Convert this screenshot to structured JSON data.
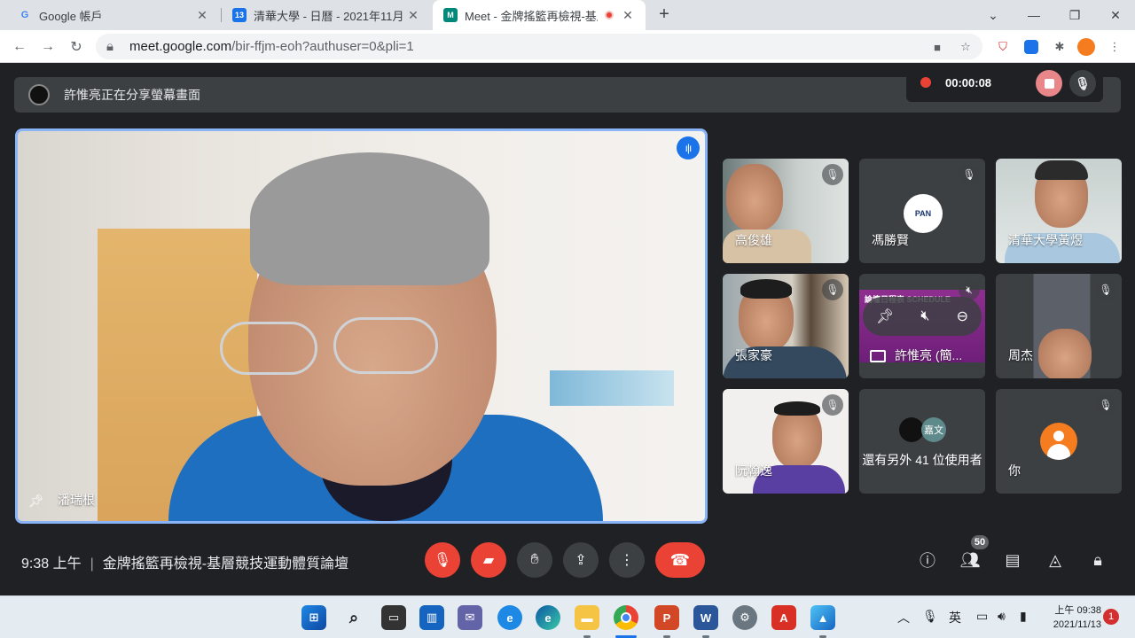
{
  "browser": {
    "tabs": [
      {
        "title": "Google 帳戶",
        "favicon": "G"
      },
      {
        "title": "清華大學 - 日曆 - 2021年11月",
        "favicon": "13"
      },
      {
        "title": "Meet - 金牌搖籃再檢視-基層",
        "favicon": "M"
      }
    ],
    "url_host": "meet.google.com",
    "url_path": "/bir-ffjm-eoh?authuser=0&pli=1"
  },
  "meet": {
    "presenting_banner": "許惟亮正在分享螢幕畫面",
    "recording_time": "00:00:08",
    "main_speaker_name": "潘瑞根",
    "tiles": [
      {
        "name": "高俊雄"
      },
      {
        "name": "馮勝賢"
      },
      {
        "name": "清華大學黃煜"
      },
      {
        "name": "張家豪"
      },
      {
        "name": "許惟亮 (簡..."
      },
      {
        "name": "周杰"
      },
      {
        "name": "阮翰逸"
      },
      {
        "name": "還有另外 41 位使用者"
      },
      {
        "name": "你"
      }
    ],
    "schedule_label": "論壇日程表 SCHEDULE",
    "others_avatar_text": "嘉文",
    "participants_count": "50",
    "time": "9:38 上午",
    "meeting_title": "金牌搖籃再檢視-基層競技運動體質論壇"
  },
  "taskbar": {
    "ime": "英",
    "time_line1": "上午 09:38",
    "time_line2": "2021/11/13",
    "notifications": "1"
  },
  "colors": {
    "accent_blue": "#1a73e8",
    "red": "#ea4335",
    "meet_bg": "#202124",
    "tile_bg": "#3c4043"
  }
}
